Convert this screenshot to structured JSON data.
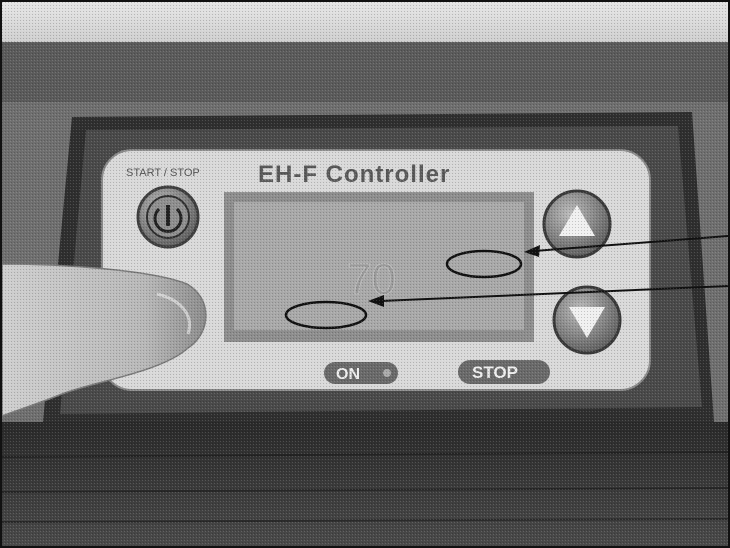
{
  "device": {
    "start_stop_label": "START / STOP",
    "title": "EH-F Controller",
    "display_text": "70"
  },
  "indicators": {
    "on_label": "ON",
    "stop_label": "STOP"
  },
  "icons": {
    "power": "power-icon",
    "up": "up-arrow-icon",
    "down": "down-arrow-icon"
  },
  "colors": {
    "panel": "#d9d9d9",
    "lcd": "#a9a9a9",
    "bezel": "#3a3a3a",
    "annotation": "#111111"
  }
}
